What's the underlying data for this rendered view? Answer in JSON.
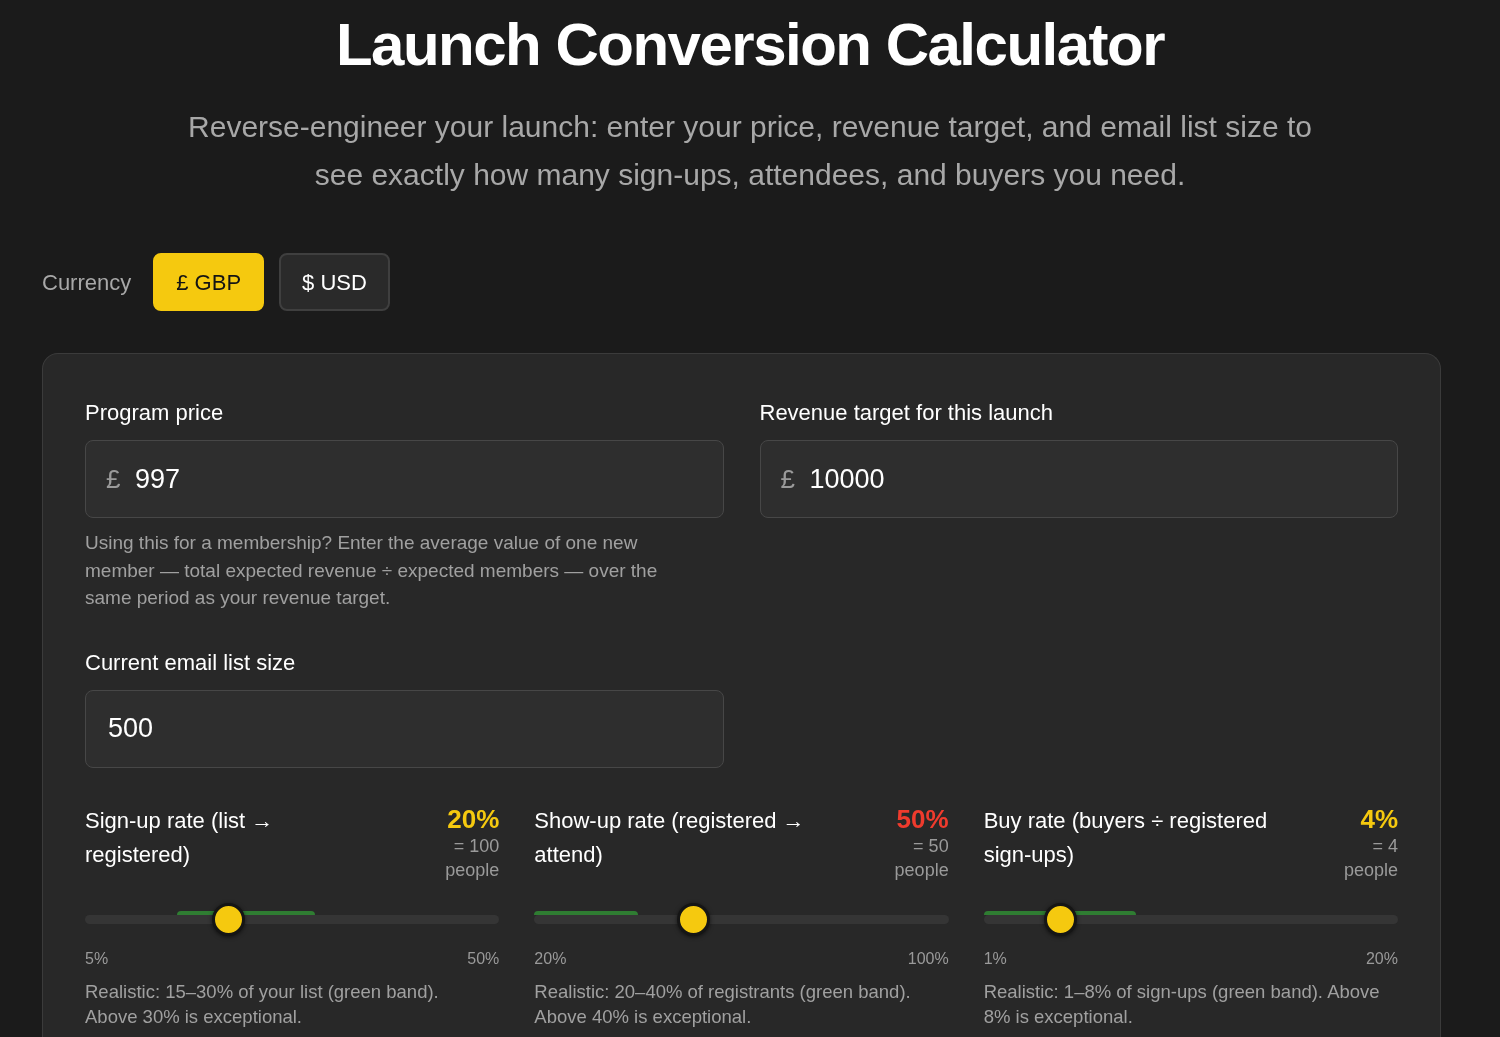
{
  "title": "Launch Conversion Calculator",
  "subtitle": "Reverse-engineer your launch: enter your price, revenue target, and email list size to see exactly how many sign-ups, attendees, and buyers you need.",
  "currency": {
    "label": "Currency",
    "options": [
      {
        "label": "£ GBP",
        "selected": true
      },
      {
        "label": "$ USD",
        "selected": false
      }
    ]
  },
  "fields": [
    {
      "label": "Program price",
      "prefix": "£",
      "value": "997",
      "help": "Using this for a membership? Enter the average value of one new member — total expected revenue ÷ expected members — over the same period as your revenue target."
    },
    {
      "label": "Revenue target for this launch",
      "prefix": "£",
      "value": "10000"
    },
    {
      "label": "Current email list size",
      "value": "500"
    }
  ],
  "sliders": [
    {
      "label": "Sign-up rate (list → registered)",
      "value": "20%",
      "exceptional": false,
      "count": "= 100 people",
      "level": 0.333,
      "min": "5%",
      "max": "50%",
      "note": "Realistic: 15–30% of your list (green band). Above 30% is exceptional."
    },
    {
      "label": "Show-up rate (registered → attend)",
      "value": "50%",
      "exceptional": true,
      "count": "= 50 people",
      "level": 0.375,
      "min": "20%",
      "max": "100%",
      "note": "Realistic: 20–40% of registrants (green band). Above 40% is exceptional."
    },
    {
      "label": "Buy rate (buyers ÷ registered sign-ups)",
      "value": "4%",
      "exceptional": false,
      "count": "= 4 people",
      "level": 0.158,
      "min": "1%",
      "max": "20%",
      "note": "Realistic: 1–8% of sign-ups (green band). Above 8% is exceptional."
    }
  ]
}
